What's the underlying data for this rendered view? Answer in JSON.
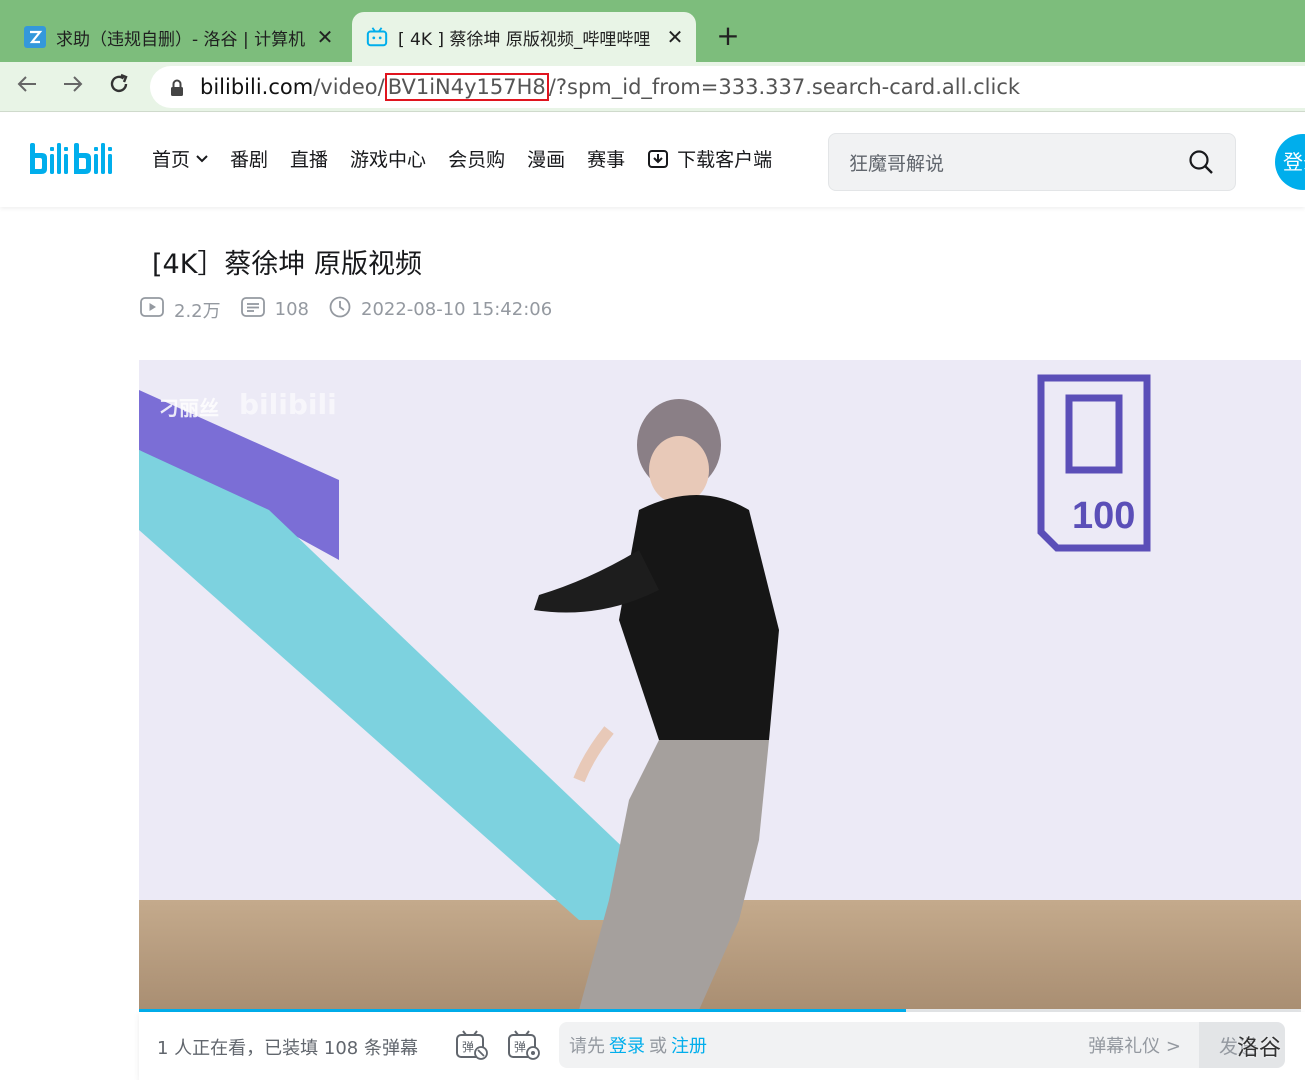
{
  "browser": {
    "tabs": [
      {
        "title": "求助（违规自删）- 洛谷 | 计算机",
        "favicon": "luogu-favicon"
      },
      {
        "title": "[ 4K ] 蔡徐坤 原版视频_哔哩哔哩",
        "favicon": "bilibili-tv-favicon"
      }
    ],
    "close_glyph": "✕",
    "new_tab_glyph": "+",
    "url": {
      "host": "bilibili.com",
      "path_prefix": "/video/",
      "highlighted": "BV1iN4y157H8",
      "rest": "/?spm_id_from=333.337.search-card.all.click"
    },
    "highlight_color": "#e0141e"
  },
  "header": {
    "logo_text": "bilibili",
    "nav": [
      {
        "label": "首页",
        "dropdown": true
      },
      {
        "label": "番剧"
      },
      {
        "label": "直播"
      },
      {
        "label": "游戏中心"
      },
      {
        "label": "会员购"
      },
      {
        "label": "漫画"
      },
      {
        "label": "赛事"
      },
      {
        "label": "下载客户端",
        "icon": "download-icon"
      }
    ],
    "search_placeholder": "狂魔哥解说",
    "login_label": "登录",
    "accent": "#00aeec"
  },
  "video": {
    "title": "[4K］蔡徐坤 原版视频",
    "views": "2.2万",
    "danmaku_count": "108",
    "publish_time": "2022-08-10 15:42:06",
    "overlay_watermark": "刁丽丝",
    "progress": 0.66
  },
  "danmaku_bar": {
    "info": "1 人正在看，已装填 108 条弹幕",
    "hint_prefix": "请先",
    "login_link": "登录",
    "or_text": "或",
    "register_link": "注册",
    "etiquette": "弹幕礼仪 >",
    "send": "发送"
  },
  "watermark": "洛谷"
}
